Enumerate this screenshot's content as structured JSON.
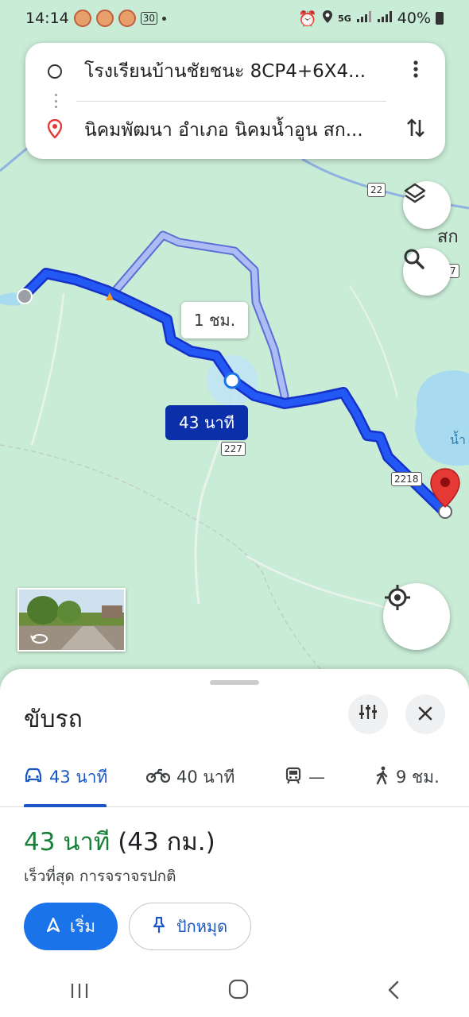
{
  "status_bar": {
    "time": "14:14",
    "notification_badge": "30",
    "network": "5G",
    "battery": "40%"
  },
  "route": {
    "origin": "โรงเรียนบ้านชัยชนะ 8CP4+6X4...",
    "destination": "นิคมพัฒนา อำเภอ นิคมน้ำอูน สก...",
    "more_icon": "more-vert-icon",
    "swap_icon": "swap-vert-icon"
  },
  "map": {
    "alt_route_time": "1 ชม.",
    "main_route_time": "43 นาที",
    "road_labels": [
      "22",
      "227",
      "2218",
      "7"
    ],
    "place_label": "สก",
    "water_label": "น้ำ",
    "colors": {
      "route": "#1a4ef0",
      "alt_route": "#a7b7f4",
      "water": "#a8dbf0",
      "destination_pin": "#e53935",
      "land": "#c9ecd6"
    }
  },
  "sheet": {
    "title": "ขับรถ",
    "tabs": [
      {
        "icon": "car-icon",
        "label": "43 นาที",
        "active": true
      },
      {
        "icon": "motorcycle-icon",
        "label": "40 นาที",
        "active": false
      },
      {
        "icon": "transit-icon",
        "label": "—",
        "active": false
      },
      {
        "icon": "walk-icon",
        "label": "9 ชม.",
        "active": false
      }
    ],
    "duration": "43 นาที",
    "distance": "(43 กม.)",
    "note": "เร็วที่สุด การจราจรปกติ",
    "start_label": "เริ่ม",
    "pin_label": "ปักหมุด"
  }
}
